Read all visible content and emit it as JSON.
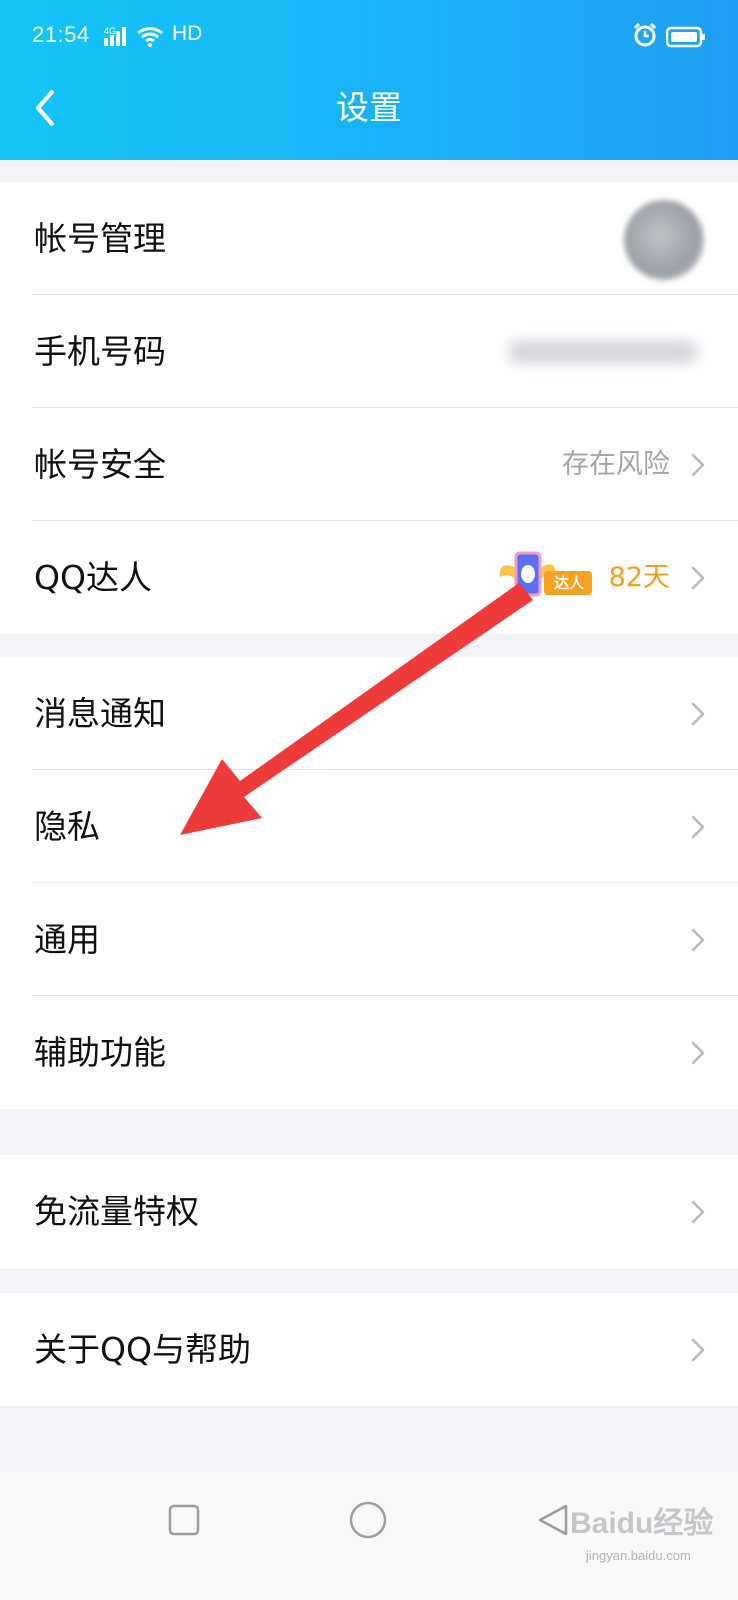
{
  "status_bar": {
    "time": "21:54",
    "network": "4G",
    "hd": "HD"
  },
  "header": {
    "title": "设置",
    "background": "#1ab1f5"
  },
  "groups": [
    {
      "rows": [
        {
          "label": "帐号管理",
          "value": "",
          "trailing": "avatar"
        },
        {
          "label": "手机号码",
          "value": "",
          "trailing": "blurred-phone-number"
        },
        {
          "label": "帐号安全",
          "value": "存在风险",
          "trailing": "chevron"
        },
        {
          "label": "QQ达人",
          "value": "82天",
          "badge": "达人",
          "trailing": "chevron"
        }
      ]
    },
    {
      "rows": [
        {
          "label": "消息通知",
          "trailing": "chevron"
        },
        {
          "label": "隐私",
          "trailing": "chevron"
        },
        {
          "label": "通用",
          "trailing": "chevron"
        },
        {
          "label": "辅助功能",
          "trailing": "chevron"
        }
      ]
    },
    {
      "rows": [
        {
          "label": "免流量特权",
          "trailing": "chevron"
        }
      ]
    },
    {
      "rows": [
        {
          "label": "关于QQ与帮助",
          "trailing": "chevron"
        }
      ]
    }
  ],
  "colors": {
    "accent_value": "#f0a020",
    "muted_value": "#a3a4a8",
    "annotation_arrow": "#ee3a3a"
  },
  "watermark": {
    "logo": "Baidu经验",
    "url": "jingyan.baidu.com"
  }
}
